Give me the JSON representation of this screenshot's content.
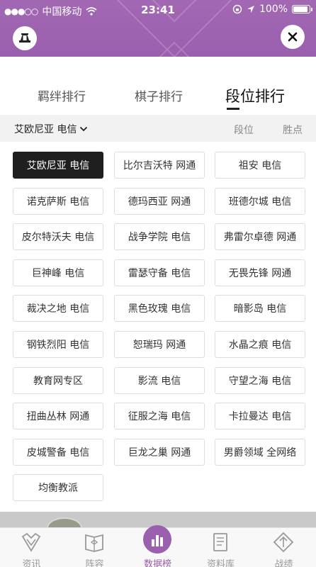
{
  "status_bar": {
    "signal": "●●●○○",
    "carrier": "中国移动",
    "time": "23:41",
    "battery": "100%"
  },
  "header": {
    "logo_icon": "league-logo-icon",
    "close_icon": "close-icon"
  },
  "tabs": [
    {
      "label": "羁绊排行",
      "active": false
    },
    {
      "label": "棋子排行",
      "active": false
    },
    {
      "label": "段位排行",
      "active": true
    }
  ],
  "filter": {
    "region": "艾欧尼亚 电信",
    "sort_rank": "段位",
    "sort_winpoints": "胜点"
  },
  "servers": [
    "艾欧尼亚 电信",
    "比尔吉沃特 网通",
    "祖安 电信",
    "诺克萨斯 电信",
    "德玛西亚 网通",
    "班德尔城 电信",
    "皮尔特沃夫 电信",
    "战争学院 电信",
    "弗雷尔卓德 网通",
    "巨神峰 电信",
    "雷瑟守备 电信",
    "无畏先锋 网通",
    "裁决之地 电信",
    "黑色玫瑰 电信",
    "暗影岛 电信",
    "钢铁烈阳 电信",
    "恕瑞玛 网通",
    "水晶之痕 电信",
    "教育网专区",
    "影流 电信",
    "守望之海 电信",
    "扭曲丛林 网通",
    "征服之海 电信",
    "卡拉曼达 电信",
    "皮城警备 电信",
    "巨龙之巢 网通",
    "男爵领域 全网络",
    "均衡教派"
  ],
  "selected_server": "艾欧尼亚 电信",
  "bottom_nav": [
    {
      "label": "资讯",
      "icon": "news-icon",
      "active": false
    },
    {
      "label": "阵容",
      "icon": "lineup-icon",
      "active": false
    },
    {
      "label": "数据榜",
      "icon": "bar-chart-icon",
      "active": true
    },
    {
      "label": "资料库",
      "icon": "database-icon",
      "active": false
    },
    {
      "label": "战绩",
      "icon": "record-icon",
      "active": false
    }
  ],
  "colors": {
    "brand_purple": "#9a5fae",
    "selected_bg": "#1f1f1f"
  }
}
